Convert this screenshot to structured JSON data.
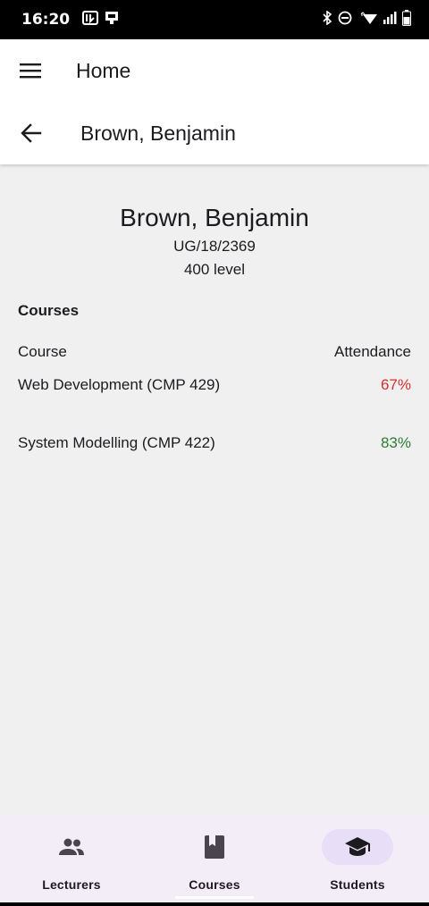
{
  "status_bar": {
    "time": "16:20",
    "left_icons": [
      "nfc-icon",
      "cast-icon"
    ],
    "right_icons": [
      "bluetooth-icon",
      "do-not-disturb-icon",
      "wifi-icon",
      "signal-icon",
      "battery-icon"
    ]
  },
  "app_bar": {
    "title": "Home",
    "menu_icon": "hamburger-menu-icon"
  },
  "sub_header": {
    "title": "Brown, Benjamin",
    "back_icon": "arrow-back-icon"
  },
  "student": {
    "name": "Brown, Benjamin",
    "id": "UG/18/2369",
    "level": "400 level"
  },
  "courses": {
    "section_title": "Courses",
    "columns": [
      "Course",
      "Attendance"
    ],
    "rows": [
      {
        "name": "Web Development (CMP 429)",
        "attendance": "67%",
        "status_color": "#d32f2f"
      },
      {
        "name": "System Modelling (CMP 422)",
        "attendance": "83%",
        "status_color": "#2e7d32"
      }
    ]
  },
  "bottom_nav": {
    "items": [
      {
        "label": "Lecturers",
        "icon": "people-icon",
        "active": false
      },
      {
        "label": "Courses",
        "icon": "book-icon",
        "active": false
      },
      {
        "label": "Students",
        "icon": "graduation-cap-icon",
        "active": true
      }
    ]
  },
  "colors": {
    "accent_active_pill": "#e8def8",
    "nav_background": "#f3edf7",
    "attendance_low": "#d32f2f",
    "attendance_high": "#2e7d32"
  }
}
